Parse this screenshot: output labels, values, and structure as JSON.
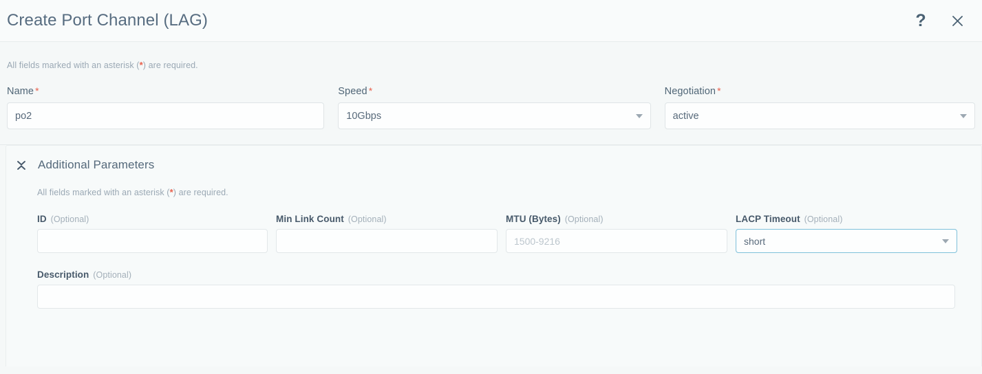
{
  "header": {
    "title": "Create Port Channel (LAG)",
    "help_icon": "question-mark-icon",
    "close_icon": "close-icon"
  },
  "required_note": {
    "prefix": "All fields marked with an asterisk (",
    "asterisk": "*",
    "suffix": ") are required."
  },
  "form": {
    "name": {
      "label": "Name",
      "required_mark": "*",
      "value": "po2"
    },
    "speed": {
      "label": "Speed",
      "required_mark": "*",
      "value": "10Gbps"
    },
    "negotiation": {
      "label": "Negotiation",
      "required_mark": "*",
      "value": "active"
    }
  },
  "additional_parameters": {
    "title": "Additional Parameters",
    "collapse_icon": "collapse-chevrons-icon",
    "note": {
      "prefix": "All fields marked with an asterisk (",
      "asterisk": "*",
      "suffix": ") are required."
    },
    "fields": {
      "id": {
        "label": "ID",
        "optional": "(Optional)",
        "value": "",
        "placeholder": ""
      },
      "min_link_count": {
        "label": "Min Link Count",
        "optional": "(Optional)",
        "value": "",
        "placeholder": ""
      },
      "mtu": {
        "label": "MTU (Bytes)",
        "optional": "(Optional)",
        "value": "",
        "placeholder": "1500-9216"
      },
      "lacp_timeout": {
        "label": "LACP Timeout",
        "optional": "(Optional)",
        "value": "short"
      },
      "description": {
        "label": "Description",
        "optional": "(Optional)",
        "value": "",
        "placeholder": ""
      }
    }
  },
  "colors": {
    "accent_focus": "#7ec0da",
    "required_asterisk": "#e8604c",
    "title_text": "#576c80",
    "page_background": "#f5f8f8"
  }
}
